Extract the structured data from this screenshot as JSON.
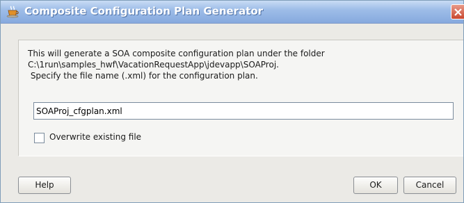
{
  "window": {
    "title": "Composite Configuration Plan Generator"
  },
  "message": {
    "line1": "This will generate a SOA composite configuration plan under the folder",
    "line2": "C:\\1run\\samples_hwf\\VacationRequestApp\\jdevapp\\SOAProj.",
    "line3": " Specify the file name (.xml) for the configuration plan."
  },
  "file_name": {
    "value": "SOAProj_cfgplan.xml"
  },
  "overwrite": {
    "label": "Overwrite existing file",
    "checked": false
  },
  "buttons": {
    "help": "Help",
    "ok": "OK",
    "cancel": "Cancel"
  },
  "icons": {
    "title_icon": "jdeveloper-cup-icon",
    "close_icon": "close-icon"
  }
}
